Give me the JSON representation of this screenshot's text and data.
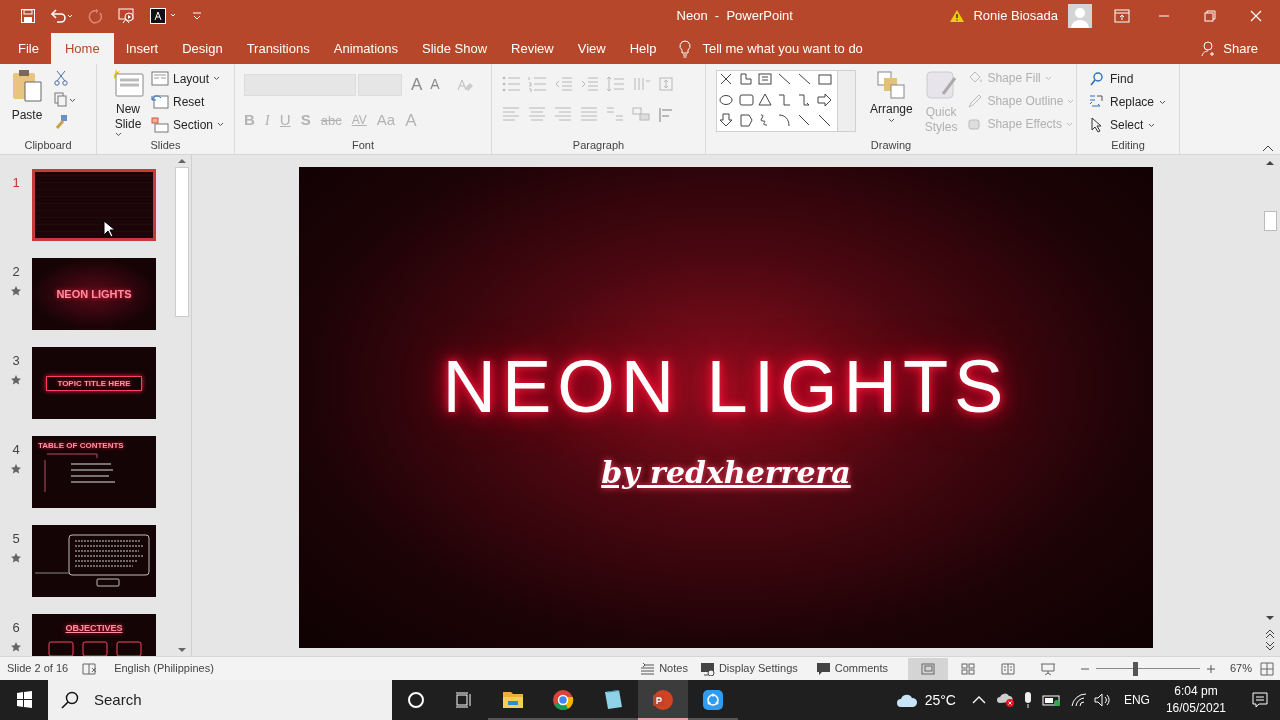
{
  "window": {
    "title": "Neon  -  PowerPoint",
    "user": "Ronie Biosada"
  },
  "tabs": [
    {
      "label": "File",
      "selected": false
    },
    {
      "label": "Home",
      "selected": true
    },
    {
      "label": "Insert",
      "selected": false
    },
    {
      "label": "Design",
      "selected": false
    },
    {
      "label": "Transitions",
      "selected": false
    },
    {
      "label": "Animations",
      "selected": false
    },
    {
      "label": "Slide Show",
      "selected": false
    },
    {
      "label": "Review",
      "selected": false
    },
    {
      "label": "View",
      "selected": false
    },
    {
      "label": "Help",
      "selected": false
    }
  ],
  "tell_me": "Tell me what you want to do",
  "share": "Share",
  "ribbon": {
    "clipboard": {
      "label": "Clipboard",
      "paste": "Paste"
    },
    "slides": {
      "label": "Slides",
      "new_slide": [
        "New",
        "Slide"
      ],
      "items": [
        "Layout",
        "Reset",
        "Section"
      ]
    },
    "font": {
      "label": "Font",
      "size_buttons": [
        {
          "label": "A",
          "disabled": false
        },
        {
          "label": "A",
          "disabled": false
        }
      ],
      "buttons": [
        {
          "label": "B",
          "disabled": true
        },
        {
          "label": "I",
          "disabled": true
        },
        {
          "label": "U",
          "disabled": true
        },
        {
          "label": "S",
          "disabled": true
        },
        {
          "label": "abc",
          "disabled": true
        },
        {
          "label": "AV",
          "disabled": true
        },
        {
          "label": "Aa",
          "disabled": true
        },
        {
          "label": "A",
          "disabled": true
        }
      ]
    },
    "paragraph": {
      "label": "Paragraph"
    },
    "drawing": {
      "label": "Drawing",
      "arrange": "Arrange",
      "quick_styles": [
        "Quick",
        "Styles"
      ],
      "items": [
        {
          "label": "Shape Fill",
          "disabled": true
        },
        {
          "label": "Shape Outline",
          "disabled": true
        },
        {
          "label": "Shape Effects",
          "disabled": true
        }
      ]
    },
    "editing": {
      "label": "Editing",
      "items": [
        {
          "label": "Find",
          "kind": "find"
        },
        {
          "label": "Replace",
          "kind": "replace"
        },
        {
          "label": "Select",
          "kind": "select"
        }
      ]
    }
  },
  "slides": [
    {
      "number": "1",
      "selected": true,
      "animated": false,
      "kind": "blank"
    },
    {
      "number": "2",
      "selected": false,
      "animated": true,
      "kind": "title",
      "title": "NEON LIGHTS"
    },
    {
      "number": "3",
      "selected": false,
      "animated": true,
      "kind": "boxed",
      "title": "TOPIC TITLE HERE"
    },
    {
      "number": "4",
      "selected": false,
      "animated": true,
      "kind": "contents",
      "title": "TABLE OF CONTENTS"
    },
    {
      "number": "5",
      "selected": false,
      "animated": true,
      "kind": "text"
    },
    {
      "number": "6",
      "selected": false,
      "animated": true,
      "kind": "title_top",
      "title": "OBJECTIVES"
    }
  ],
  "slide": {
    "title": "NEON LIGHTS",
    "subtitle": "by redxherrera"
  },
  "status_bar": {
    "slide": "Slide 2 of 16",
    "language": "English (Philippines)",
    "notes": "Notes",
    "display": "Display Settings",
    "comments": "Comments",
    "views": [
      {
        "kind": "normal",
        "selected": true
      },
      {
        "kind": "sorter",
        "selected": false
      },
      {
        "kind": "reading",
        "selected": false
      },
      {
        "kind": "show",
        "selected": false
      }
    ],
    "zoom": {
      "level": 0.38,
      "reading": "67%"
    }
  },
  "taskbar": {
    "search": "Search",
    "apps": [
      {
        "kind": "explorer",
        "selected": false
      },
      {
        "kind": "chrome",
        "selected": false
      },
      {
        "kind": "notepad",
        "selected": false
      },
      {
        "kind": "powerpoint",
        "selected": true
      },
      {
        "kind": "shareit",
        "selected": false
      }
    ],
    "temperature": "25°C",
    "language": "ENG",
    "time": "6:04 pm",
    "date": "16/05/2021"
  }
}
